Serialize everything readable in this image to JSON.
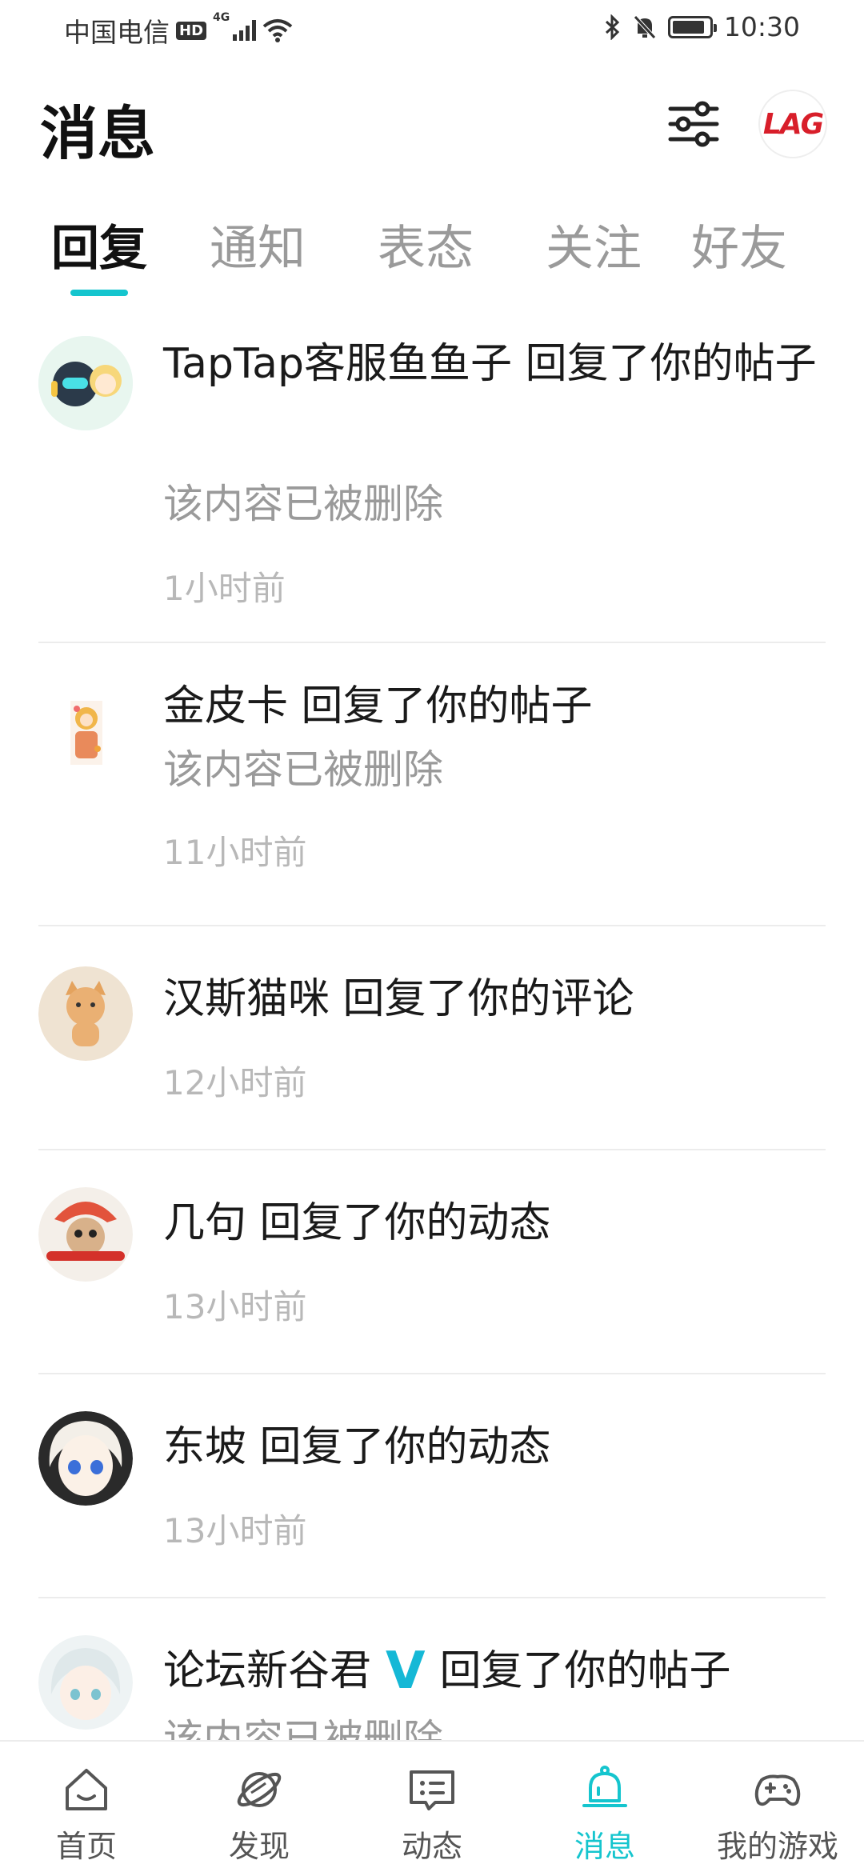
{
  "status_bar": {
    "carrier": "中国电信",
    "hd": "HD",
    "network": "4G",
    "time": "10:30",
    "battery_level": 0.9
  },
  "header": {
    "title": "消息",
    "logo_text": "LAG"
  },
  "tabs": [
    {
      "label": "回复",
      "active": true
    },
    {
      "label": "通知",
      "active": false
    },
    {
      "label": "表态",
      "active": false
    },
    {
      "label": "关注",
      "active": false
    },
    {
      "label": "好友",
      "active": false
    }
  ],
  "messages": [
    {
      "title": "TapTap客服鱼鱼子 回复了你的帖子",
      "body": "该内容已被删除",
      "time": "1小时前"
    },
    {
      "title": "金皮卡 回复了你的帖子",
      "body": "该内容已被删除",
      "time": "11小时前"
    },
    {
      "title": "汉斯猫咪 回复了你的评论",
      "body": "",
      "time": "12小时前"
    },
    {
      "title": "几句 回复了你的动态",
      "body": "",
      "time": "13小时前"
    },
    {
      "title": "东坡 回复了你的动态",
      "body": "",
      "time": "13小时前"
    },
    {
      "title_name": "论坛新谷君",
      "verified_mark": "V",
      "title_action": "回复了你的帖子",
      "body": "该内容已被删除",
      "time": ""
    }
  ],
  "bottom_nav": [
    {
      "label": "首页",
      "icon": "home-icon",
      "active": false
    },
    {
      "label": "发现",
      "icon": "planet-icon",
      "active": false
    },
    {
      "label": "动态",
      "icon": "message-card-icon",
      "active": false
    },
    {
      "label": "消息",
      "icon": "bell-icon",
      "active": true
    },
    {
      "label": "我的游戏",
      "icon": "gamepad-icon",
      "active": false
    }
  ],
  "colors": {
    "accent": "#15c5ce",
    "verified": "#15b8d6",
    "logo_red": "#d81e2a",
    "muted_text": "#9a9a9a",
    "time_text": "#b8b8b8"
  }
}
